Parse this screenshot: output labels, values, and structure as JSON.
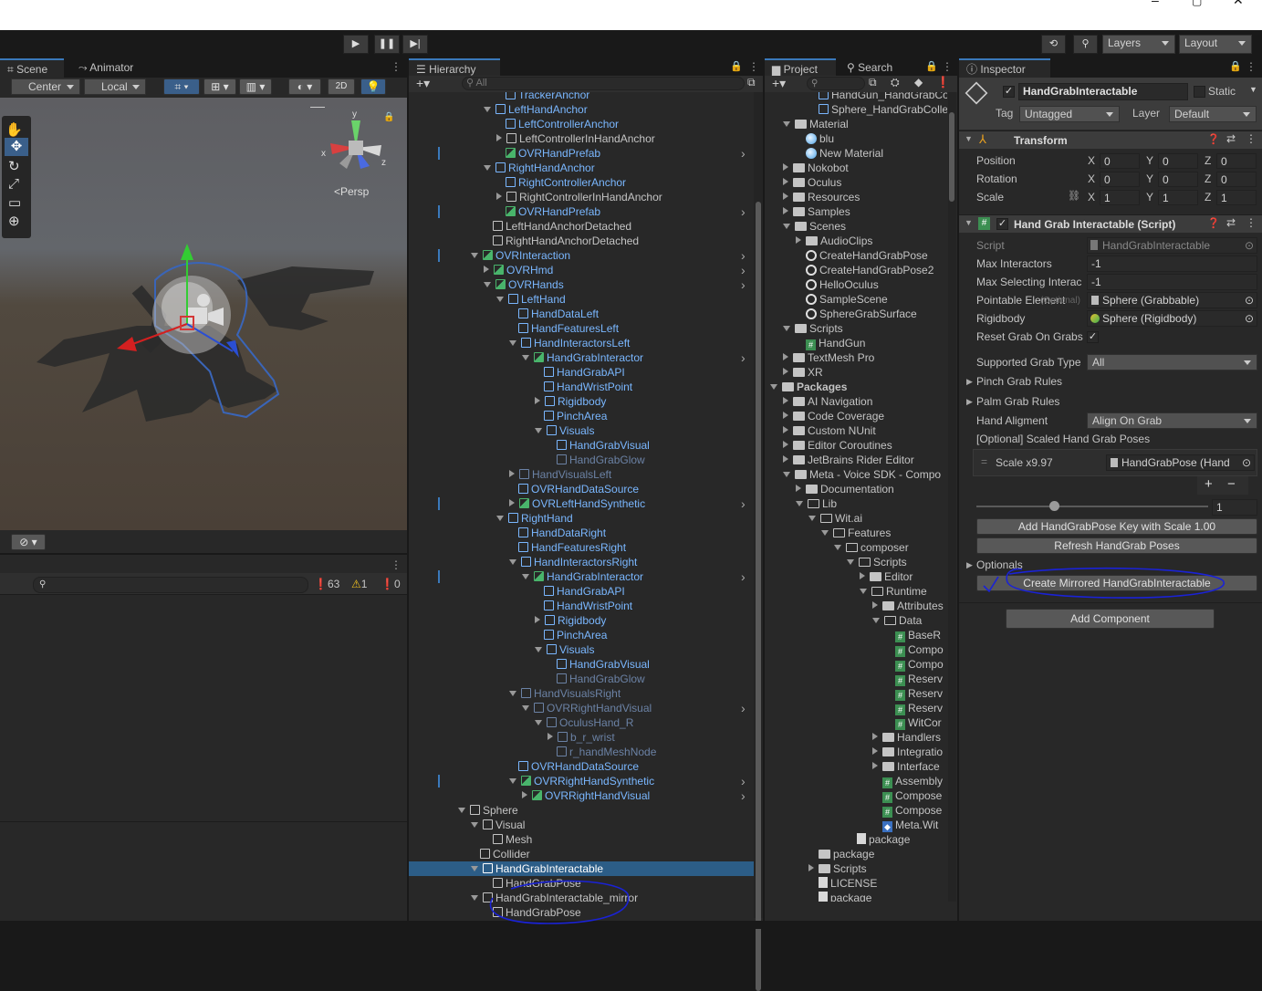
{
  "toolbar": {
    "layers": "Layers",
    "layout": "Layout"
  },
  "scene": {
    "tabs": [
      "Scene",
      "Animator"
    ],
    "pivot": "Center",
    "space": "Local",
    "mode2d": "2D",
    "persp": "<Persp",
    "axes": {
      "x": "x",
      "y": "y",
      "z": "z"
    }
  },
  "console": {
    "errors": "63",
    "warnings": "1",
    "infos": "0"
  },
  "hierarchy": {
    "title": "Hierarchy",
    "search_placeholder": "All",
    "rows": [
      {
        "t": "TrackerAnchor",
        "d": 4,
        "i": "cube",
        "c": "blue",
        "a": ""
      },
      {
        "t": "LeftHandAnchor",
        "d": 3,
        "i": "cube",
        "c": "blue",
        "a": "down"
      },
      {
        "t": "LeftControllerAnchor",
        "d": 4,
        "i": "cube",
        "c": "blue",
        "a": ""
      },
      {
        "t": "LeftControllerInHandAnchor",
        "d": 4,
        "i": "cube",
        "c": "",
        "a": "right"
      },
      {
        "t": "OVRHandPrefab",
        "d": 4,
        "i": "prefab",
        "c": "blue",
        "a": "",
        "more": true,
        "bar": true
      },
      {
        "t": "RightHandAnchor",
        "d": 3,
        "i": "cube",
        "c": "blue",
        "a": "down"
      },
      {
        "t": "RightControllerAnchor",
        "d": 4,
        "i": "cube",
        "c": "blue",
        "a": ""
      },
      {
        "t": "RightControllerInHandAnchor",
        "d": 4,
        "i": "cube",
        "c": "",
        "a": "right"
      },
      {
        "t": "OVRHandPrefab",
        "d": 4,
        "i": "prefab",
        "c": "blue",
        "a": "",
        "more": true,
        "bar": true
      },
      {
        "t": "LeftHandAnchorDetached",
        "d": 3,
        "i": "cube",
        "c": "",
        "a": ""
      },
      {
        "t": "RightHandAnchorDetached",
        "d": 3,
        "i": "cube",
        "c": "",
        "a": ""
      },
      {
        "t": "OVRInteraction",
        "d": 2,
        "i": "prefab",
        "c": "blue",
        "a": "down",
        "more": true,
        "bar": true
      },
      {
        "t": "OVRHmd",
        "d": 3,
        "i": "prefab",
        "c": "blue",
        "a": "right",
        "more": true
      },
      {
        "t": "OVRHands",
        "d": 3,
        "i": "prefab",
        "c": "blue",
        "a": "down",
        "more": true
      },
      {
        "t": "LeftHand",
        "d": 4,
        "i": "cube",
        "c": "blue",
        "a": "down"
      },
      {
        "t": "HandDataLeft",
        "d": 5,
        "i": "cube",
        "c": "blue",
        "a": ""
      },
      {
        "t": "HandFeaturesLeft",
        "d": 5,
        "i": "cube",
        "c": "blue",
        "a": ""
      },
      {
        "t": "HandInteractorsLeft",
        "d": 5,
        "i": "cube",
        "c": "blue",
        "a": "down"
      },
      {
        "t": "HandGrabInteractor",
        "d": 6,
        "i": "prefab",
        "c": "blue",
        "a": "down",
        "more": true
      },
      {
        "t": "HandGrabAPI",
        "d": 7,
        "i": "cube",
        "c": "blue",
        "a": ""
      },
      {
        "t": "HandWristPoint",
        "d": 7,
        "i": "cube",
        "c": "blue",
        "a": ""
      },
      {
        "t": "Rigidbody",
        "d": 7,
        "i": "cube",
        "c": "blue",
        "a": "right"
      },
      {
        "t": "PinchArea",
        "d": 7,
        "i": "cube",
        "c": "blue",
        "a": ""
      },
      {
        "t": "Visuals",
        "d": 7,
        "i": "cube",
        "c": "blue",
        "a": "down"
      },
      {
        "t": "HandGrabVisual",
        "d": 8,
        "i": "cube",
        "c": "blue",
        "a": ""
      },
      {
        "t": "HandGrabGlow",
        "d": 8,
        "i": "cube",
        "c": "faded",
        "a": ""
      },
      {
        "t": "HandVisualsLeft",
        "d": 5,
        "i": "cube",
        "c": "faded",
        "a": "right"
      },
      {
        "t": "OVRHandDataSource",
        "d": 5,
        "i": "cube",
        "c": "blue",
        "a": ""
      },
      {
        "t": "OVRLeftHandSynthetic",
        "d": 5,
        "i": "prefab",
        "c": "blue",
        "a": "right",
        "more": true,
        "bar": true
      },
      {
        "t": "RightHand",
        "d": 4,
        "i": "cube",
        "c": "blue",
        "a": "down"
      },
      {
        "t": "HandDataRight",
        "d": 5,
        "i": "cube",
        "c": "blue",
        "a": ""
      },
      {
        "t": "HandFeaturesRight",
        "d": 5,
        "i": "cube",
        "c": "blue",
        "a": ""
      },
      {
        "t": "HandInteractorsRight",
        "d": 5,
        "i": "cube",
        "c": "blue",
        "a": "down"
      },
      {
        "t": "HandGrabInteractor",
        "d": 6,
        "i": "prefab",
        "c": "blue",
        "a": "down",
        "more": true,
        "bar": true
      },
      {
        "t": "HandGrabAPI",
        "d": 7,
        "i": "cube",
        "c": "blue",
        "a": ""
      },
      {
        "t": "HandWristPoint",
        "d": 7,
        "i": "cube",
        "c": "blue",
        "a": ""
      },
      {
        "t": "Rigidbody",
        "d": 7,
        "i": "cube",
        "c": "blue",
        "a": "right"
      },
      {
        "t": "PinchArea",
        "d": 7,
        "i": "cube",
        "c": "blue",
        "a": ""
      },
      {
        "t": "Visuals",
        "d": 7,
        "i": "cube",
        "c": "blue",
        "a": "down"
      },
      {
        "t": "HandGrabVisual",
        "d": 8,
        "i": "cube",
        "c": "blue",
        "a": ""
      },
      {
        "t": "HandGrabGlow",
        "d": 8,
        "i": "cube",
        "c": "faded",
        "a": ""
      },
      {
        "t": "HandVisualsRight",
        "d": 5,
        "i": "cube",
        "c": "faded",
        "a": "down"
      },
      {
        "t": "OVRRightHandVisual",
        "d": 6,
        "i": "prefabf",
        "c": "faded",
        "a": "down",
        "more": true
      },
      {
        "t": "OculusHand_R",
        "d": 7,
        "i": "cube",
        "c": "faded",
        "a": "down"
      },
      {
        "t": "b_r_wrist",
        "d": 8,
        "i": "cube",
        "c": "faded",
        "a": "right"
      },
      {
        "t": "r_handMeshNode",
        "d": 8,
        "i": "cube",
        "c": "faded",
        "a": ""
      },
      {
        "t": "OVRHandDataSource",
        "d": 5,
        "i": "cube",
        "c": "blue",
        "a": ""
      },
      {
        "t": "OVRRightHandSynthetic",
        "d": 5,
        "i": "prefab",
        "c": "blue",
        "a": "down",
        "more": true,
        "bar": true
      },
      {
        "t": "OVRRightHandVisual",
        "d": 6,
        "i": "prefab",
        "c": "blue",
        "a": "right",
        "more": true
      },
      {
        "t": "Sphere",
        "d": 1,
        "i": "cube",
        "c": "",
        "a": "down"
      },
      {
        "t": "Visual",
        "d": 2,
        "i": "cube",
        "c": "",
        "a": "down"
      },
      {
        "t": "Mesh",
        "d": 3,
        "i": "cube",
        "c": "",
        "a": ""
      },
      {
        "t": "Collider",
        "d": 2,
        "i": "cube",
        "c": "",
        "a": ""
      },
      {
        "t": "HandGrabInteractable",
        "d": 2,
        "i": "cube",
        "c": "",
        "a": "down",
        "sel": true
      },
      {
        "t": "HandGrabPose",
        "d": 3,
        "i": "cube",
        "c": "",
        "a": ""
      },
      {
        "t": "HandGrabInteractable_mirror",
        "d": 2,
        "i": "cube",
        "c": "",
        "a": "down"
      },
      {
        "t": "HandGrabPose",
        "d": 3,
        "i": "cube",
        "c": "",
        "a": ""
      }
    ]
  },
  "project": {
    "tabs": [
      "Project",
      "Search"
    ],
    "rows": [
      {
        "t": "HandGun_HandGrabCol",
        "d": 3,
        "i": "prefab",
        "a": ""
      },
      {
        "t": "Sphere_HandGrabCollec",
        "d": 3,
        "i": "prefab",
        "a": ""
      },
      {
        "t": "Material",
        "d": 1,
        "i": "folder",
        "a": "down"
      },
      {
        "t": "blu",
        "d": 2,
        "i": "mat",
        "a": ""
      },
      {
        "t": "New Material",
        "d": 2,
        "i": "mat",
        "a": ""
      },
      {
        "t": "Nokobot",
        "d": 1,
        "i": "folder",
        "a": "right"
      },
      {
        "t": "Oculus",
        "d": 1,
        "i": "folder",
        "a": "right"
      },
      {
        "t": "Resources",
        "d": 1,
        "i": "folder",
        "a": "right"
      },
      {
        "t": "Samples",
        "d": 1,
        "i": "folder",
        "a": "right"
      },
      {
        "t": "Scenes",
        "d": 1,
        "i": "folder",
        "a": "down"
      },
      {
        "t": "AudioClips",
        "d": 2,
        "i": "folder",
        "a": "right"
      },
      {
        "t": "CreateHandGrabPose",
        "d": 2,
        "i": "unity",
        "a": ""
      },
      {
        "t": "CreateHandGrabPose2",
        "d": 2,
        "i": "unity",
        "a": ""
      },
      {
        "t": "HelloOculus",
        "d": 2,
        "i": "unity",
        "a": ""
      },
      {
        "t": "SampleScene",
        "d": 2,
        "i": "unity",
        "a": ""
      },
      {
        "t": "SphereGrabSurface",
        "d": 2,
        "i": "unity",
        "a": ""
      },
      {
        "t": "Scripts",
        "d": 1,
        "i": "folder",
        "a": "down"
      },
      {
        "t": "HandGun",
        "d": 2,
        "i": "hash",
        "a": ""
      },
      {
        "t": "TextMesh Pro",
        "d": 1,
        "i": "folder",
        "a": "right"
      },
      {
        "t": "XR",
        "d": 1,
        "i": "folder",
        "a": "right"
      },
      {
        "t": "Packages",
        "d": 0,
        "i": "folder",
        "a": "down",
        "bold": true
      },
      {
        "t": "AI Navigation",
        "d": 1,
        "i": "folder",
        "a": "right"
      },
      {
        "t": "Code Coverage",
        "d": 1,
        "i": "folder",
        "a": "right"
      },
      {
        "t": "Custom NUnit",
        "d": 1,
        "i": "folder",
        "a": "right"
      },
      {
        "t": "Editor Coroutines",
        "d": 1,
        "i": "folder",
        "a": "right"
      },
      {
        "t": "JetBrains Rider Editor",
        "d": 1,
        "i": "folder",
        "a": "right"
      },
      {
        "t": "Meta - Voice SDK - Compo",
        "d": 1,
        "i": "folder",
        "a": "down"
      },
      {
        "t": "Documentation",
        "d": 2,
        "i": "folder",
        "a": "right"
      },
      {
        "t": "Lib",
        "d": 2,
        "i": "folderO",
        "a": "down"
      },
      {
        "t": "Wit.ai",
        "d": 3,
        "i": "folderO",
        "a": "down"
      },
      {
        "t": "Features",
        "d": 4,
        "i": "folderO",
        "a": "down"
      },
      {
        "t": "composer",
        "d": 5,
        "i": "folderO",
        "a": "down"
      },
      {
        "t": "Scripts",
        "d": 6,
        "i": "folderO",
        "a": "down"
      },
      {
        "t": "Editor",
        "d": 7,
        "i": "folder",
        "a": "right"
      },
      {
        "t": "Runtime",
        "d": 7,
        "i": "folderO",
        "a": "down"
      },
      {
        "t": "Attributes",
        "d": 8,
        "i": "folder",
        "a": "right"
      },
      {
        "t": "Data",
        "d": 8,
        "i": "folderO",
        "a": "down"
      },
      {
        "t": "BaseR",
        "d": 9,
        "i": "hash",
        "a": ""
      },
      {
        "t": "Compo",
        "d": 9,
        "i": "hash",
        "a": ""
      },
      {
        "t": "Compo",
        "d": 9,
        "i": "hash",
        "a": ""
      },
      {
        "t": "Reserv",
        "d": 9,
        "i": "hash",
        "a": ""
      },
      {
        "t": "Reserv",
        "d": 9,
        "i": "hash",
        "a": ""
      },
      {
        "t": "Reserv",
        "d": 9,
        "i": "hash",
        "a": ""
      },
      {
        "t": "WitCor",
        "d": 9,
        "i": "hash",
        "a": ""
      },
      {
        "t": "Handlers",
        "d": 8,
        "i": "folder",
        "a": "right"
      },
      {
        "t": "Integratio",
        "d": 8,
        "i": "folder",
        "a": "right"
      },
      {
        "t": "Interface",
        "d": 8,
        "i": "folder",
        "a": "right"
      },
      {
        "t": "Assembly",
        "d": 8,
        "i": "hash",
        "a": ""
      },
      {
        "t": "Compose",
        "d": 8,
        "i": "hash",
        "a": ""
      },
      {
        "t": "Compose",
        "d": 8,
        "i": "hash",
        "a": ""
      },
      {
        "t": "Meta.Wit",
        "d": 8,
        "i": "asm",
        "a": ""
      },
      {
        "t": "package",
        "d": 6,
        "i": "doc",
        "a": ""
      },
      {
        "t": "package",
        "d": 3,
        "i": "folder",
        "a": ""
      },
      {
        "t": "Scripts",
        "d": 3,
        "i": "folder",
        "a": "right"
      },
      {
        "t": "LICENSE",
        "d": 3,
        "i": "doc",
        "a": ""
      },
      {
        "t": "package",
        "d": 3,
        "i": "doc",
        "a": ""
      }
    ]
  },
  "inspector": {
    "title": "Inspector",
    "object_name": "HandGrabInteractable",
    "static_label": "Static",
    "tag_label": "Tag",
    "tag_value": "Untagged",
    "layer_label": "Layer",
    "layer_value": "Default",
    "transform": {
      "title": "Transform",
      "position_label": "Position",
      "rotation_label": "Rotation",
      "scale_label": "Scale",
      "position": [
        "0",
        "0",
        "0"
      ],
      "rotation": [
        "0",
        "0",
        "0"
      ],
      "scale": [
        "1",
        "1",
        "1"
      ]
    },
    "script_comp": {
      "title": "Hand Grab Interactable (Script)",
      "script_label": "Script",
      "script_value": "HandGrabInteractable",
      "max_interactors_label": "Max Interactors",
      "max_interactors": "-1",
      "max_selecting_label": "Max Selecting Interac",
      "max_selecting": "-1",
      "pointable_label": "Pointable Element",
      "pointable_hint": "(Optional)",
      "pointable_value": "Sphere (Grabbable)",
      "rigidbody_label": "Rigidbody",
      "rigidbody_value": "Sphere (Rigidbody)",
      "reset_label": "Reset Grab On Grabs",
      "grab_type_label": "Supported Grab Type",
      "grab_type_value": "All",
      "pinch_label": "Pinch Grab Rules",
      "palm_label": "Palm Grab Rules",
      "alignment_label": "Hand Aligment",
      "alignment_value": "Align On Grab",
      "poses_label": "[Optional] Scaled Hand Grab Poses",
      "scale_entry_label": "Scale x9.97",
      "scale_entry_value": "HandGrabPose (Hand",
      "slider_value": "1",
      "add_pose_btn": "Add HandGrabPose Key with Scale 1.00",
      "refresh_btn": "Refresh HandGrab Poses",
      "optionals_label": "Optionals",
      "mirror_btn": "Create Mirrored HandGrabInteractable",
      "plus": "+",
      "minus": "−"
    },
    "add_component": "Add Component"
  },
  "colors": {
    "accent": "#3a79bb",
    "selection": "#2c5d87",
    "prefab_blue": "#7ab7ff",
    "annotation": "#1a22d6"
  }
}
